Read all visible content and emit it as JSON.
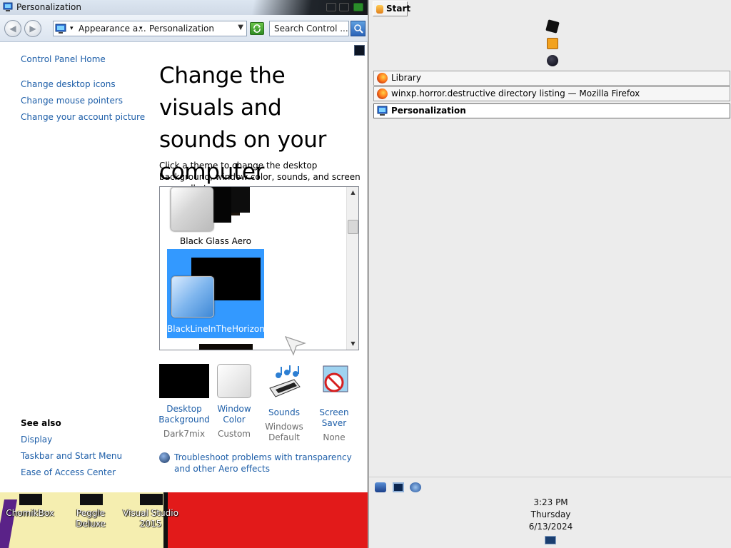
{
  "window": {
    "title": "Personalization"
  },
  "address_bar": {
    "crumb1": "Appearance a...",
    "crumb2": "Personalization",
    "arrow1": "▾",
    "arrow2": "▾",
    "dropdown": "▼",
    "search_placeholder": "Search Control ..."
  },
  "nav_buttons": {
    "back": "◀",
    "forward": "▶"
  },
  "left_pane": {
    "home": "Control Panel Home",
    "links": [
      "Change desktop icons",
      "Change mouse pointers",
      "Change your account picture"
    ],
    "see_also_title": "See also",
    "see_also": [
      "Display",
      "Taskbar and Start Menu",
      "Ease of Access Center"
    ]
  },
  "main": {
    "heading": "Change the visuals and sounds on your computer",
    "subtext": "Click a theme to change the desktop background, window color, sounds, and screen saver all at once.",
    "themes": [
      {
        "name": "Black Glass Aero",
        "selected": false
      },
      {
        "name": "BlackLineInTheHorizon",
        "selected": true
      }
    ],
    "scroll_up": "▲",
    "scroll_down": "▼"
  },
  "bottom_items": [
    {
      "title": "Desktop Background",
      "sub": "Dark7mix",
      "icon": "desktop-background-icon"
    },
    {
      "title": "Window Color",
      "sub": "Custom",
      "icon": "window-color-icon"
    },
    {
      "title": "Sounds",
      "sub": "Windows Default",
      "icon": "sounds-icon"
    },
    {
      "title": "Screen Saver",
      "sub": "None",
      "icon": "screen-saver-icon"
    }
  ],
  "troubleshoot": "Troubleshoot problems with transparency and other Aero effects",
  "desktop_icons": [
    {
      "label": "ChomikBox"
    },
    {
      "label": "Peggle Deluxe"
    },
    {
      "label": "Visual Studio 2015"
    }
  ],
  "taskbar": {
    "start_label": "Start",
    "tasks": [
      {
        "label": "Library",
        "active": false,
        "icon": "firefox-icon"
      },
      {
        "label": "winxp.horror.destructive directory listing — Mozilla Firefox",
        "active": false,
        "icon": "firefox-icon"
      },
      {
        "label": "Personalization",
        "active": true,
        "icon": "control-panel-icon"
      }
    ],
    "clock": {
      "time": "3:23 PM",
      "day": "Thursday",
      "date": "6/13/2024"
    }
  },
  "colors": {
    "link": "#1d5ea8",
    "selection": "#3399ff",
    "desktop_red": "#e21a1a"
  }
}
